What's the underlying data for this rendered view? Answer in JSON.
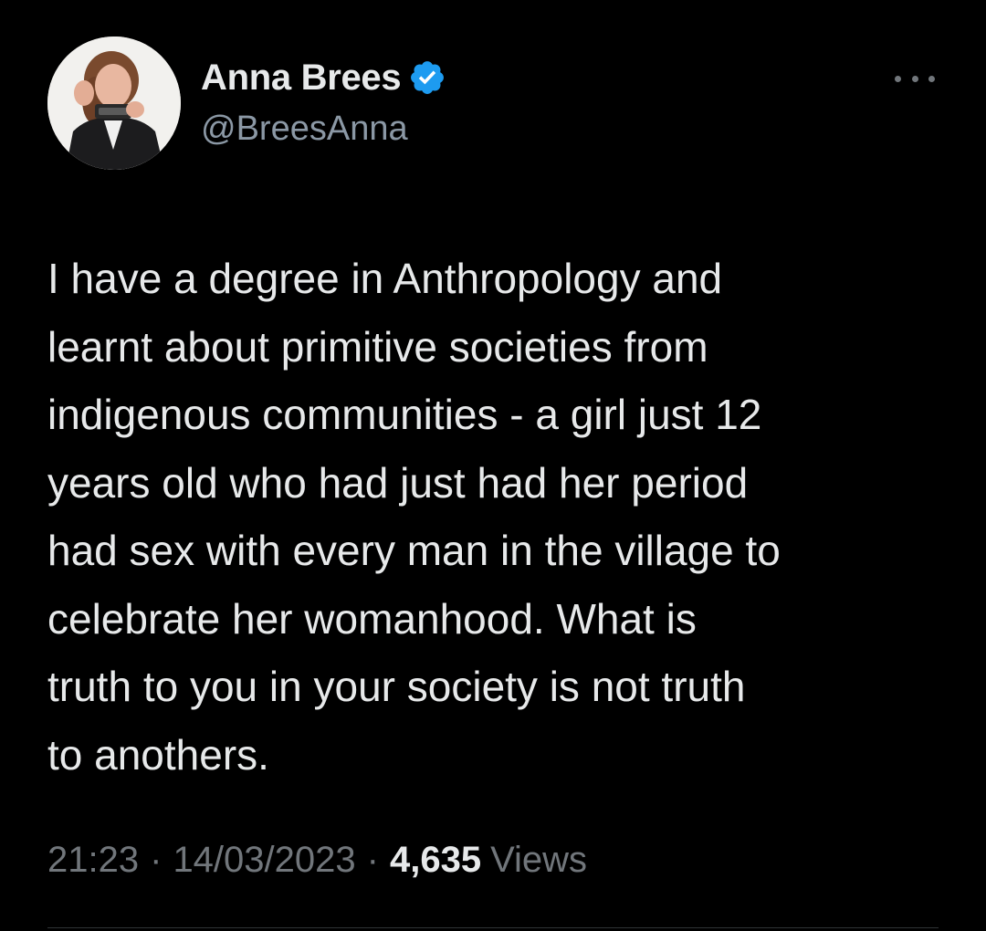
{
  "author": {
    "display_name": "Anna Brees",
    "handle": "@BreesAnna",
    "verified": true,
    "verified_color": "#1d9bf0"
  },
  "tweet": {
    "text": "I have a degree in Anthropology and\nlearnt about primitive societies from\nindigenous communities - a girl just 12\nyears old who had just had her period\nhad sex with every man in the village to\ncelebrate her womanhood. What is\ntruth to you in your society is not truth\nto anothers."
  },
  "meta": {
    "time": "21:23",
    "separator": "·",
    "date": "14/03/2023",
    "views_count": "4,635",
    "views_label": "Views"
  },
  "icons": {
    "more": "more-horizontal-icon",
    "verified": "verified-badge-icon"
  },
  "colors": {
    "background": "#000000",
    "text_primary": "#e7e9ea",
    "text_secondary": "#71767b"
  }
}
